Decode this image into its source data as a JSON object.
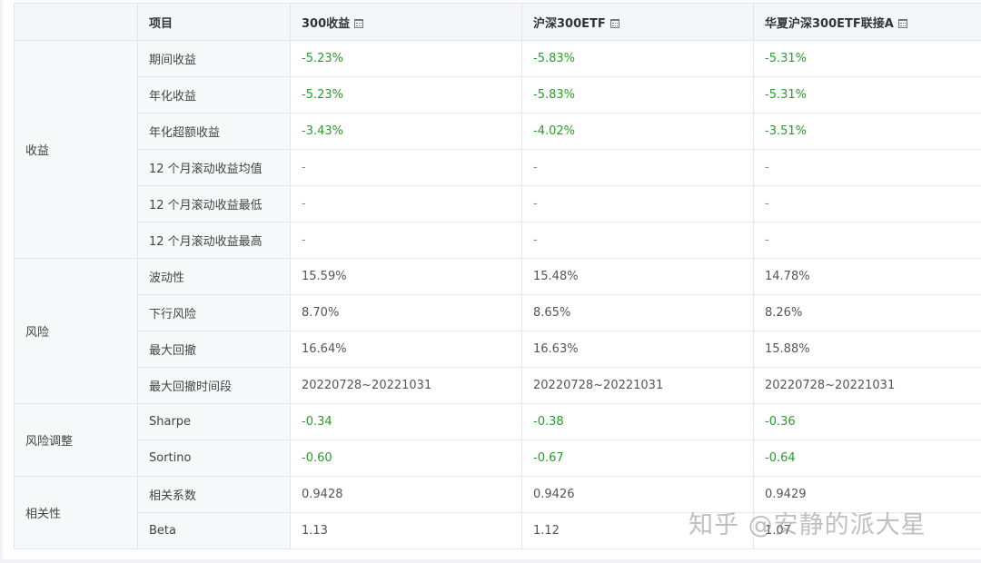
{
  "table": {
    "headers": {
      "item": "项目",
      "col_a": "300收益",
      "col_b": "沪深300ETF",
      "col_c": "华夏沪深300ETF联接A"
    },
    "sections": {
      "returns": {
        "label": "收益",
        "rows": [
          {
            "item": "期间收益",
            "a": "-5.23%",
            "b": "-5.83%",
            "c": "-5.31%"
          },
          {
            "item": "年化收益",
            "a": "-5.23%",
            "b": "-5.83%",
            "c": "-5.31%"
          },
          {
            "item": "年化超额收益",
            "a": "-3.43%",
            "b": "-4.02%",
            "c": "-3.51%"
          },
          {
            "item": "12 个月滚动收益均值",
            "a": "-",
            "b": "-",
            "c": "-"
          },
          {
            "item": "12 个月滚动收益最低",
            "a": "-",
            "b": "-",
            "c": "-"
          },
          {
            "item": "12 个月滚动收益最高",
            "a": "-",
            "b": "-",
            "c": "-"
          }
        ]
      },
      "risk": {
        "label": "风险",
        "rows": [
          {
            "item": "波动性",
            "a": "15.59%",
            "b": "15.48%",
            "c": "14.78%"
          },
          {
            "item": "下行风险",
            "a": "8.70%",
            "b": "8.65%",
            "c": "8.26%"
          },
          {
            "item": "最大回撤",
            "a": "16.64%",
            "b": "16.63%",
            "c": "15.88%"
          },
          {
            "item": "最大回撤时间段",
            "a": "20220728~20221031",
            "b": "20220728~20221031",
            "c": "20220728~20221031"
          }
        ]
      },
      "risk_adjusted": {
        "label": "风险调整",
        "rows": [
          {
            "item": "Sharpe",
            "a": "-0.34",
            "b": "-0.38",
            "c": "-0.36"
          },
          {
            "item": "Sortino",
            "a": "-0.60",
            "b": "-0.67",
            "c": "-0.64"
          }
        ]
      },
      "correlation": {
        "label": "相关性",
        "rows": [
          {
            "item": "相关系数",
            "a": "0.9428",
            "b": "0.9426",
            "c": "0.9429"
          },
          {
            "item": "Beta",
            "a": "1.13",
            "b": "1.12",
            "c": "1.07"
          }
        ]
      }
    }
  },
  "watermark": "知乎 @安静的派大星",
  "colors": {
    "negative": "#2c9a2c",
    "header_bg": "#f4f6f9",
    "label_bg": "#f7f8fa",
    "border": "#e3e6eb"
  }
}
